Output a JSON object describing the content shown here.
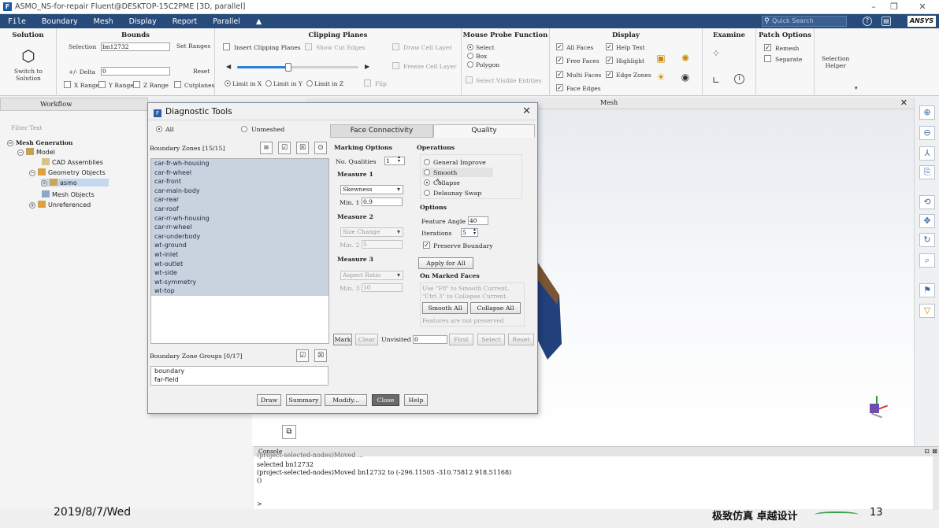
{
  "window": {
    "title": "ASMO_NS-for-repair Fluent@DESKTOP-15C2PME  [3D, parallel]"
  },
  "menu": {
    "items": [
      "File",
      "Boundary",
      "Mesh",
      "Display",
      "Report",
      "Parallel"
    ],
    "search_placeholder": "Quick Search",
    "brand": "ANSYS"
  },
  "ribbon": {
    "solution": {
      "title": "Solution",
      "button": "Switch to\nSolution"
    },
    "bounds": {
      "title": "Bounds",
      "selection_label": "Selection",
      "selection_value": "bn12732",
      "set_ranges": "Set Ranges",
      "delta_label": "+/- Delta",
      "delta_value": "0",
      "reset": "Reset",
      "x_range": "X Range",
      "y_range": "Y Range",
      "z_range": "Z Range",
      "cutplanes": "Cutplanes"
    },
    "clipping": {
      "title": "Clipping Planes",
      "insert": "Insert Clipping Planes",
      "show_cut": "Show Cut Edges",
      "draw_cell": "Draw Cell Layer",
      "freeze_cell": "Freeze Cell Layer",
      "limit_x": "Limit in X",
      "limit_y": "Limit in Y",
      "limit_z": "Limit in Z",
      "flip": "Flip",
      "slider": 0.42
    },
    "probe": {
      "title": "Mouse Probe Function",
      "select": "Select",
      "box": "Box",
      "polygon": "Polygon",
      "select_visible": "Select Visible Entities"
    },
    "display": {
      "title": "Display",
      "all_faces": "All Faces",
      "free_faces": "Free Faces",
      "multi_faces": "Multi Faces",
      "face_edges": "Face Edges",
      "help_text": "Help Text",
      "highlight": "Highlight",
      "edge_zones": "Edge Zones"
    },
    "examine": {
      "title": "Examine"
    },
    "patch": {
      "title": "Patch Options",
      "remesh": "Remesh",
      "separate": "Separate"
    },
    "selection_helper": "Selection\nHelper"
  },
  "left": {
    "tab": "Workflow",
    "filter": "Filter Text",
    "tree": {
      "root": "Mesh Generation",
      "model": "Model",
      "cad": "CAD Assemblies",
      "geom": "Geometry Objects",
      "asmo": "asmo",
      "mesh_obj": "Mesh Objects",
      "unref": "Unreferenced"
    }
  },
  "view": {
    "title": "Mesh"
  },
  "dialog": {
    "title": "Diagnostic Tools",
    "filter_all": "All",
    "filter_unmeshed": "Unmeshed",
    "zones_label": "Boundary Zones [15/15]",
    "zones": [
      "car-fr-wh-housing",
      "car-fr-wheel",
      "car-front",
      "car-main-body",
      "car-rear",
      "car-roof",
      "car-rr-wh-housing",
      "car-rr-wheel",
      "car-underbody",
      "wt-ground",
      "wt-inlet",
      "wt-outlet",
      "wt-side",
      "wt-symmetry",
      "wt-top"
    ],
    "groups_label": "Boundary Zone Groups [0/17]",
    "groups": [
      "boundary",
      "far-field"
    ],
    "tabs": [
      "Face Connectivity",
      "Quality"
    ],
    "marking": {
      "title": "Marking Options",
      "nq_label": "No. Qualities",
      "nq_value": "1",
      "m1": "Measure 1",
      "m1_sel": "Skewness",
      "m1_min_label": "Min. 1",
      "m1_min": "0.9",
      "m2": "Measure 2",
      "m2_sel": "Size Change",
      "m2_min_label": "Min. 2",
      "m2_min": "5",
      "m3": "Measure 3",
      "m3_sel": "Aspect Ratio",
      "m3_min_label": "Min. 3",
      "m3_min": "10"
    },
    "ops": {
      "title": "Operations",
      "general": "General Improve",
      "smooth": "Smooth",
      "collapse": "Collapse",
      "delaunay": "Delaunay Swap",
      "options": "Options",
      "feature_label": "Feature Angle",
      "feature_value": "40",
      "iter_label": "Iterations",
      "iter_value": "5",
      "preserve": "Preserve Boundary",
      "apply_all": "Apply for All",
      "marked": "On Marked Faces",
      "hint": "Use \"F8\" to Smooth Current,\n\"Ctrl 3\" to Collapse Current.",
      "smooth_all": "Smooth All",
      "collapse_all": "Collapse All",
      "note": "Features are not preserved"
    },
    "mark_row": {
      "mark": "Mark",
      "clear": "Clear",
      "unvisited": "Unvisited",
      "unvisited_value": "0",
      "first": "First",
      "select": "Select",
      "reset": "Reset"
    },
    "footer": [
      "Draw",
      "Summary",
      "Modify...",
      "Close",
      "Help"
    ]
  },
  "console": {
    "title": "Console",
    "lines": [
      "(project-selected-nodes)Moved ...",
      "selected bn12732",
      "(project-selected-nodes)Moved bn12732 to (-296.11505 -310.75812 918.51168)",
      "()",
      "",
      ">"
    ]
  },
  "overlay": {
    "date": "2019/8/7/Wed",
    "slogan": "极致仿真 卓越设计",
    "page": "13"
  }
}
